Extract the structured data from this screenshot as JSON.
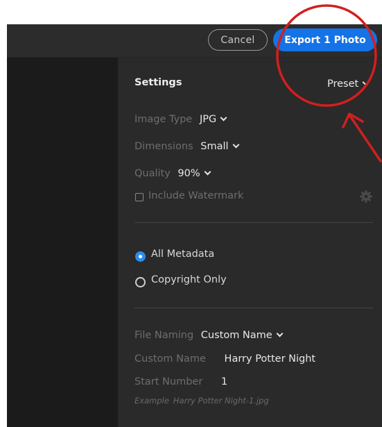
{
  "toolbar": {
    "cancel_label": "Cancel",
    "export_label": "Export 1 Photo"
  },
  "settings": {
    "header": "Settings",
    "preset_label": "Preset",
    "image_type": {
      "label": "Image Type",
      "value": "JPG"
    },
    "dimensions": {
      "label": "Dimensions",
      "value": "Small"
    },
    "quality": {
      "label": "Quality",
      "value": "90%"
    },
    "watermark": {
      "label": "Include Watermark",
      "checked": false
    }
  },
  "metadata": {
    "options": [
      {
        "label": "All Metadata",
        "selected": true
      },
      {
        "label": "Copyright Only",
        "selected": false
      }
    ]
  },
  "naming": {
    "file_naming": {
      "label": "File Naming",
      "value": "Custom Name"
    },
    "custom_name": {
      "label": "Custom Name",
      "value": "Harry Potter Night"
    },
    "start_number": {
      "label": "Start Number",
      "value": "1"
    },
    "example": {
      "label": "Example",
      "value": "Harry Potter Night-1.jpg"
    }
  },
  "colors": {
    "accent": "#1473e6",
    "annotation": "#d11f1f"
  },
  "icons": [
    "gear-icon",
    "chevron-down-icon",
    "checkbox-icon",
    "radio-icon"
  ]
}
